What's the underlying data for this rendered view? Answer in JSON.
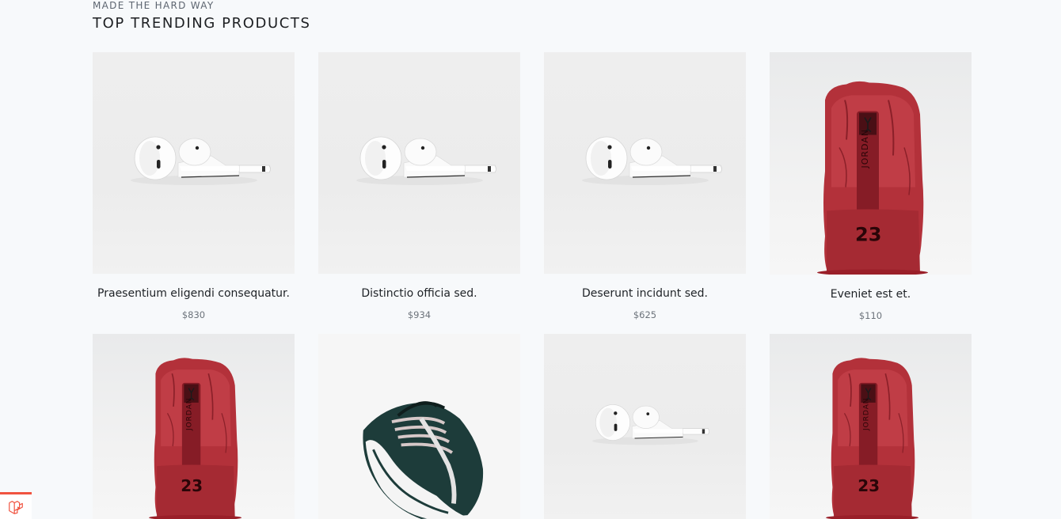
{
  "section": {
    "eyebrow": "MADE THE HARD WAY",
    "title": "TOP TRENDING PRODUCTS"
  },
  "products": [
    {
      "name": "Praesentium eligendi consequatur.",
      "price": "$830",
      "image": "airpods-image"
    },
    {
      "name": "Distinctio officia sed.",
      "price": "$934",
      "image": "airpods-image"
    },
    {
      "name": "Deserunt incidunt sed.",
      "price": "$625",
      "image": "airpods-image"
    },
    {
      "name": "Eveniet est et.",
      "price": "$110",
      "image": "red-jordan-sneaker-image"
    },
    {
      "name": "",
      "price": "",
      "image": "red-jordan-sneaker-image"
    },
    {
      "name": "",
      "price": "",
      "image": "green-sneaker-image"
    },
    {
      "name": "",
      "price": "",
      "image": "airpods-image"
    },
    {
      "name": "",
      "price": "",
      "image": "red-jordan-sneaker-image"
    }
  ],
  "sneaker_text": {
    "brand": "JORDAN",
    "number": "23"
  },
  "colors": {
    "background": "#f7f9fb",
    "sneaker_red": "#b3313a",
    "laravel_red": "#f05340"
  },
  "badge": {
    "icon": "laravel-icon"
  }
}
